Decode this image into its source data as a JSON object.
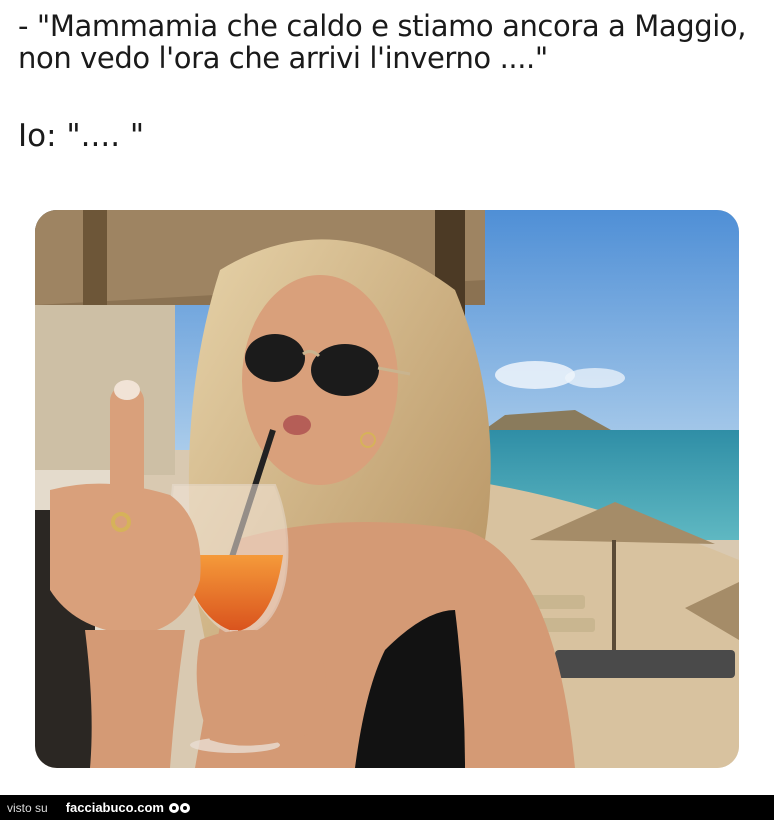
{
  "caption": {
    "line1": "- \"Mammamia che caldo e stiamo ancora a Maggio,",
    "line2": "non vedo l'ora che arrivi l'inverno ....\"",
    "reply": "Io: \".... \""
  },
  "photo": {
    "description_icon": "woman-beach-photo"
  },
  "footer": {
    "visto_label": "visto su",
    "site_label": "facciabuco.com",
    "logo_icon": "eyes-logo-icon"
  },
  "colors": {
    "footer_bg": "#000000",
    "text": "#1a1a1a",
    "sea": "#3f9fb4",
    "sky": "#5d9ad8",
    "sand": "#d8c29f"
  }
}
